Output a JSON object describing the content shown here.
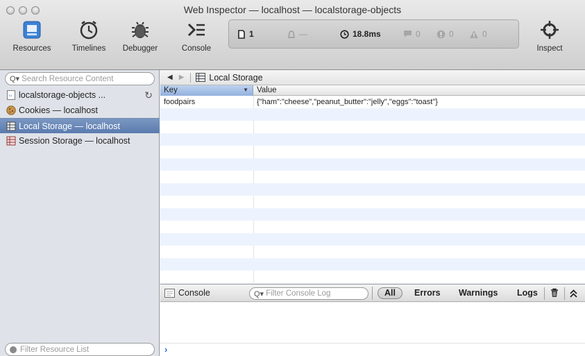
{
  "window": {
    "title": "Web Inspector — localhost — localstorage-objects"
  },
  "toolbar": {
    "resources_label": "Resources",
    "timelines_label": "Timelines",
    "debugger_label": "Debugger",
    "console_label": "Console",
    "inspect_label": "Inspect"
  },
  "dashboard": {
    "resources_count": "1",
    "resources_size": "—",
    "load_time": "18.8ms",
    "logs": "0",
    "errors": "0",
    "warnings": "0"
  },
  "sidebar": {
    "search_placeholder": "Search Resource Content",
    "items": [
      {
        "label": "localstorage-objects ..."
      },
      {
        "label": "Cookies — localhost"
      },
      {
        "label": "Local Storage — localhost"
      },
      {
        "label": "Session Storage — localhost"
      }
    ],
    "filter_placeholder": "Filter Resource List"
  },
  "navbar": {
    "title": "Local Storage"
  },
  "grid": {
    "columns": [
      "Key",
      "Value"
    ],
    "rows": [
      {
        "key": "foodpairs",
        "value": "{\"ham\":\"cheese\",\"peanut_butter\":\"jelly\",\"eggs\":\"toast\"}"
      }
    ]
  },
  "console": {
    "label": "Console",
    "filter_placeholder": "Filter Console Log",
    "filters": [
      "All",
      "Errors",
      "Warnings",
      "Logs"
    ],
    "prompt": "›"
  },
  "colors": {
    "selection": "#5b7baf",
    "row_alt": "#edf3fe",
    "prompt": "#2d6fd1"
  }
}
